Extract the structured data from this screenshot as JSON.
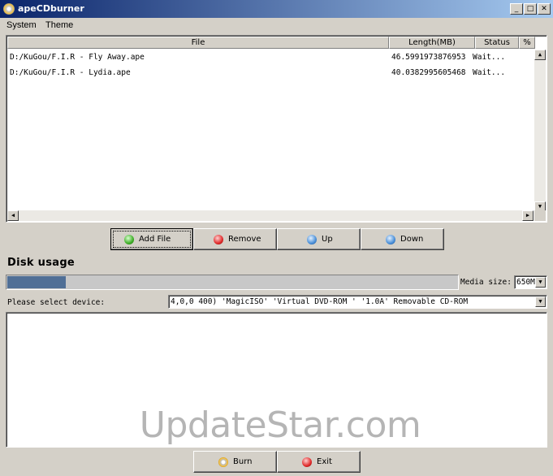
{
  "window": {
    "title": "apeCDburner",
    "minimize_glyph": "_",
    "maximize_glyph": "□",
    "close_glyph": "✕"
  },
  "menu": {
    "system": "System",
    "theme": "Theme"
  },
  "file_list": {
    "columns": [
      "File",
      "Length(MB)",
      "Status",
      "%"
    ],
    "rows": [
      {
        "file": "D:/KuGou/F.I.R - Fly Away.ape",
        "length": "46.5991973876953",
        "status": "Wait...",
        "percent": ""
      },
      {
        "file": "D:/KuGou/F.I.R - Lydia.ape",
        "length": "40.0382995605468",
        "status": "Wait...",
        "percent": ""
      }
    ]
  },
  "buttons": {
    "add_file": "Add File",
    "remove": "Remove",
    "up": "Up",
    "down": "Down",
    "burn": "Burn",
    "exit": "Exit"
  },
  "disk_usage": {
    "title": "Disk usage",
    "fill_fraction": 0.13,
    "media_size_label": "Media size:",
    "media_size_value": "650M"
  },
  "device": {
    "label": "Please select device:",
    "selected": "4,0,0   400) 'MagicISO' 'Virtual DVD-ROM ' '1.0A' Removable CD-ROM"
  },
  "watermark": "UpdateStar.com",
  "colors": {
    "titlebar_start": "#0a246a",
    "titlebar_end": "#a6caf0",
    "progress_fill": "#506f96",
    "window_bg": "#d4d0c8"
  },
  "icons": {
    "app": "cd-disc-icon",
    "add_file": "green-plus-icon",
    "remove": "red-minus-icon",
    "up": "blue-up-icon",
    "down": "blue-down-icon",
    "burn": "cd-disc-icon",
    "exit": "red-exit-icon"
  }
}
